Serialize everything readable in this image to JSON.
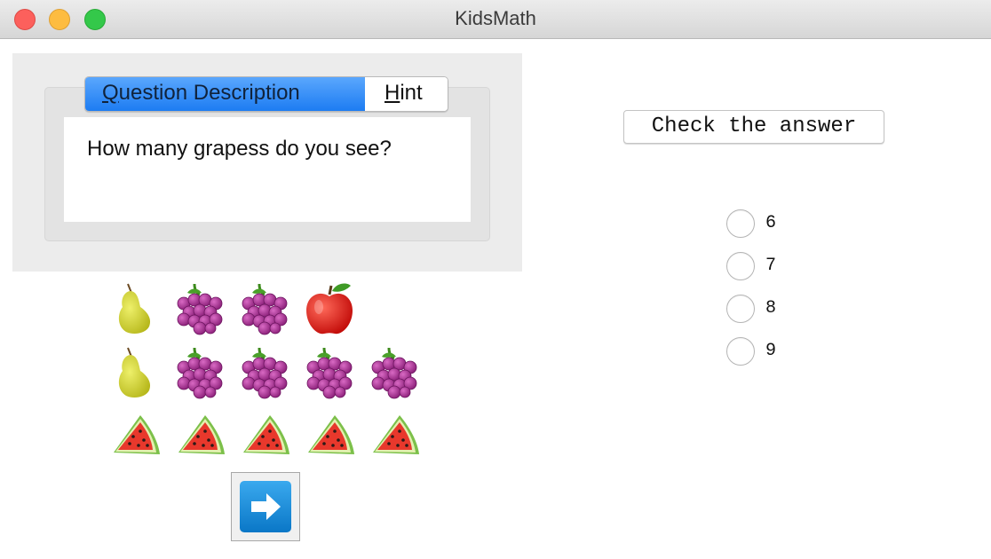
{
  "window": {
    "title": "KidsMath"
  },
  "tabs": [
    {
      "label": "Question Description",
      "mnemonic": "Q",
      "rest": "uestion Description",
      "selected": true
    },
    {
      "label": "Hint",
      "mnemonic": "H",
      "rest": "int",
      "selected": false
    }
  ],
  "question": {
    "text": "How many grapess do you see?"
  },
  "fruits": {
    "rows": [
      [
        "pear-icon",
        "grapes-icon",
        "grapes-icon",
        "apple-icon"
      ],
      [
        "pear-icon",
        "grapes-icon",
        "grapes-icon",
        "grapes-icon",
        "grapes-icon"
      ],
      [
        "watermelon-icon",
        "watermelon-icon",
        "watermelon-icon",
        "watermelon-icon",
        "watermelon-icon"
      ]
    ]
  },
  "next_button": {
    "icon": "arrow-right-icon"
  },
  "check_button": {
    "label": "Check the answer"
  },
  "answers": {
    "options": [
      "6",
      "7",
      "8",
      "9"
    ],
    "selected": null
  },
  "colors": {
    "tab_active": "#1d7cf2",
    "next_button": "#0a77c7"
  }
}
